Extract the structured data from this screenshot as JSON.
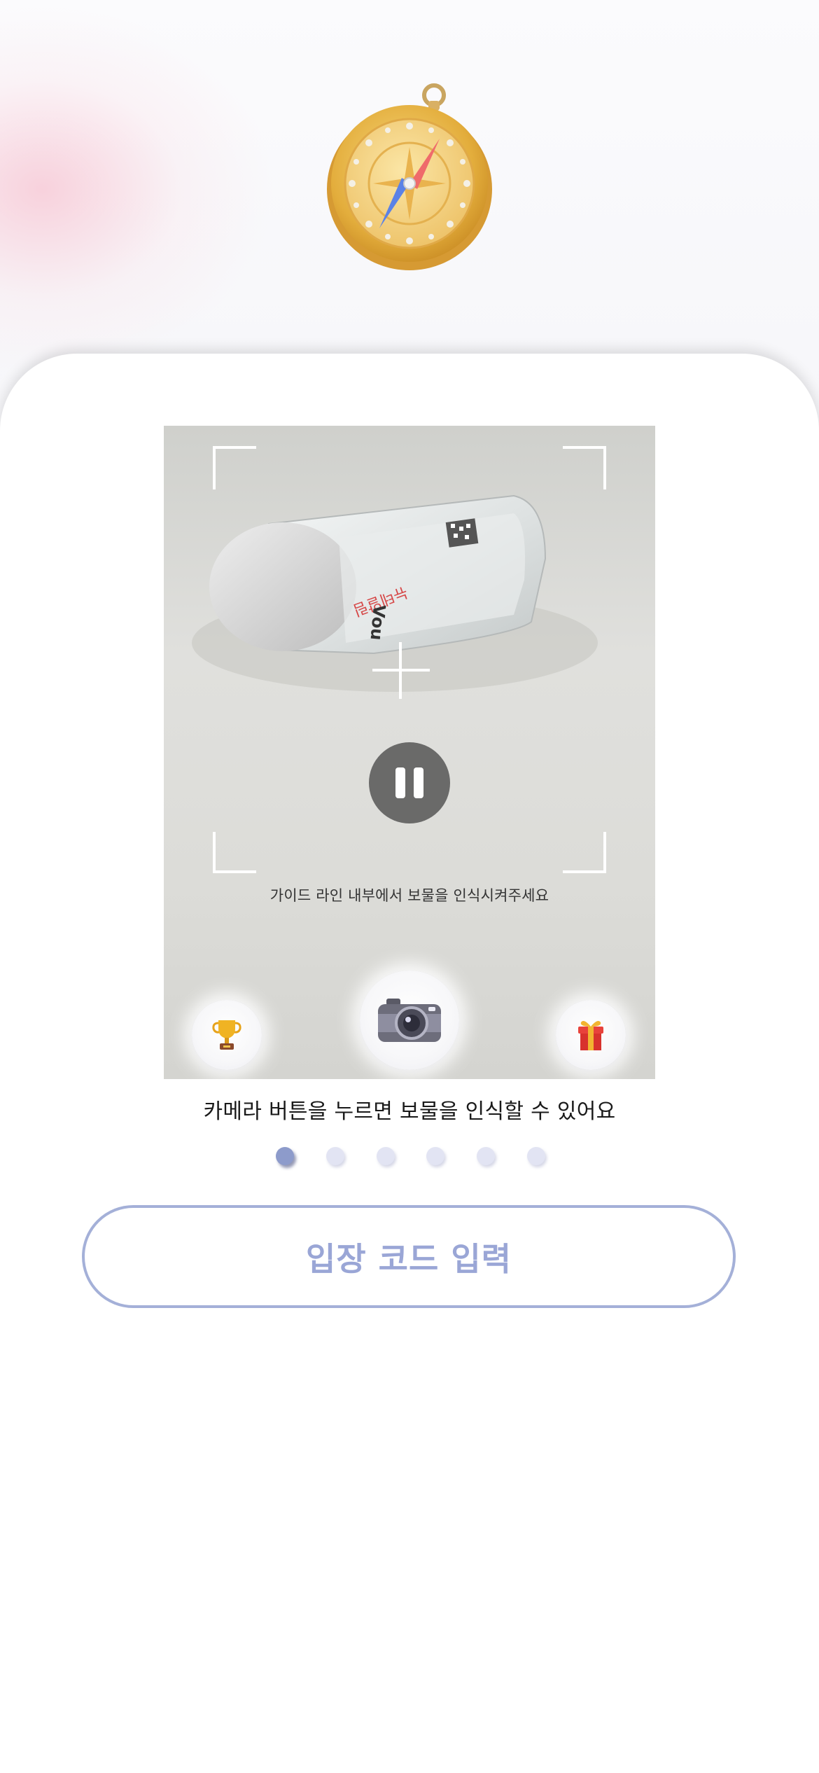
{
  "header": {
    "icon": "compass-icon"
  },
  "scanner": {
    "guide_text": "가이드 라인 내부에서 보물을 인식시켜주세요",
    "pause_icon": "pause-icon",
    "buttons": [
      {
        "name": "trophy-button",
        "icon": "trophy-icon"
      },
      {
        "name": "camera-button",
        "icon": "camera-icon"
      },
      {
        "name": "gift-button",
        "icon": "gift-icon"
      }
    ]
  },
  "onboarding": {
    "hint": "카메라 버튼을 누르면 보물을 인식할 수 있어요",
    "page_count": 6,
    "active_page": 1
  },
  "entry": {
    "code_button_label": "입장 코드 입력"
  },
  "colors": {
    "accent": "#9aa6d6",
    "active_dot": "#8d9bcb",
    "inactive_dot": "#e2e4f3"
  }
}
